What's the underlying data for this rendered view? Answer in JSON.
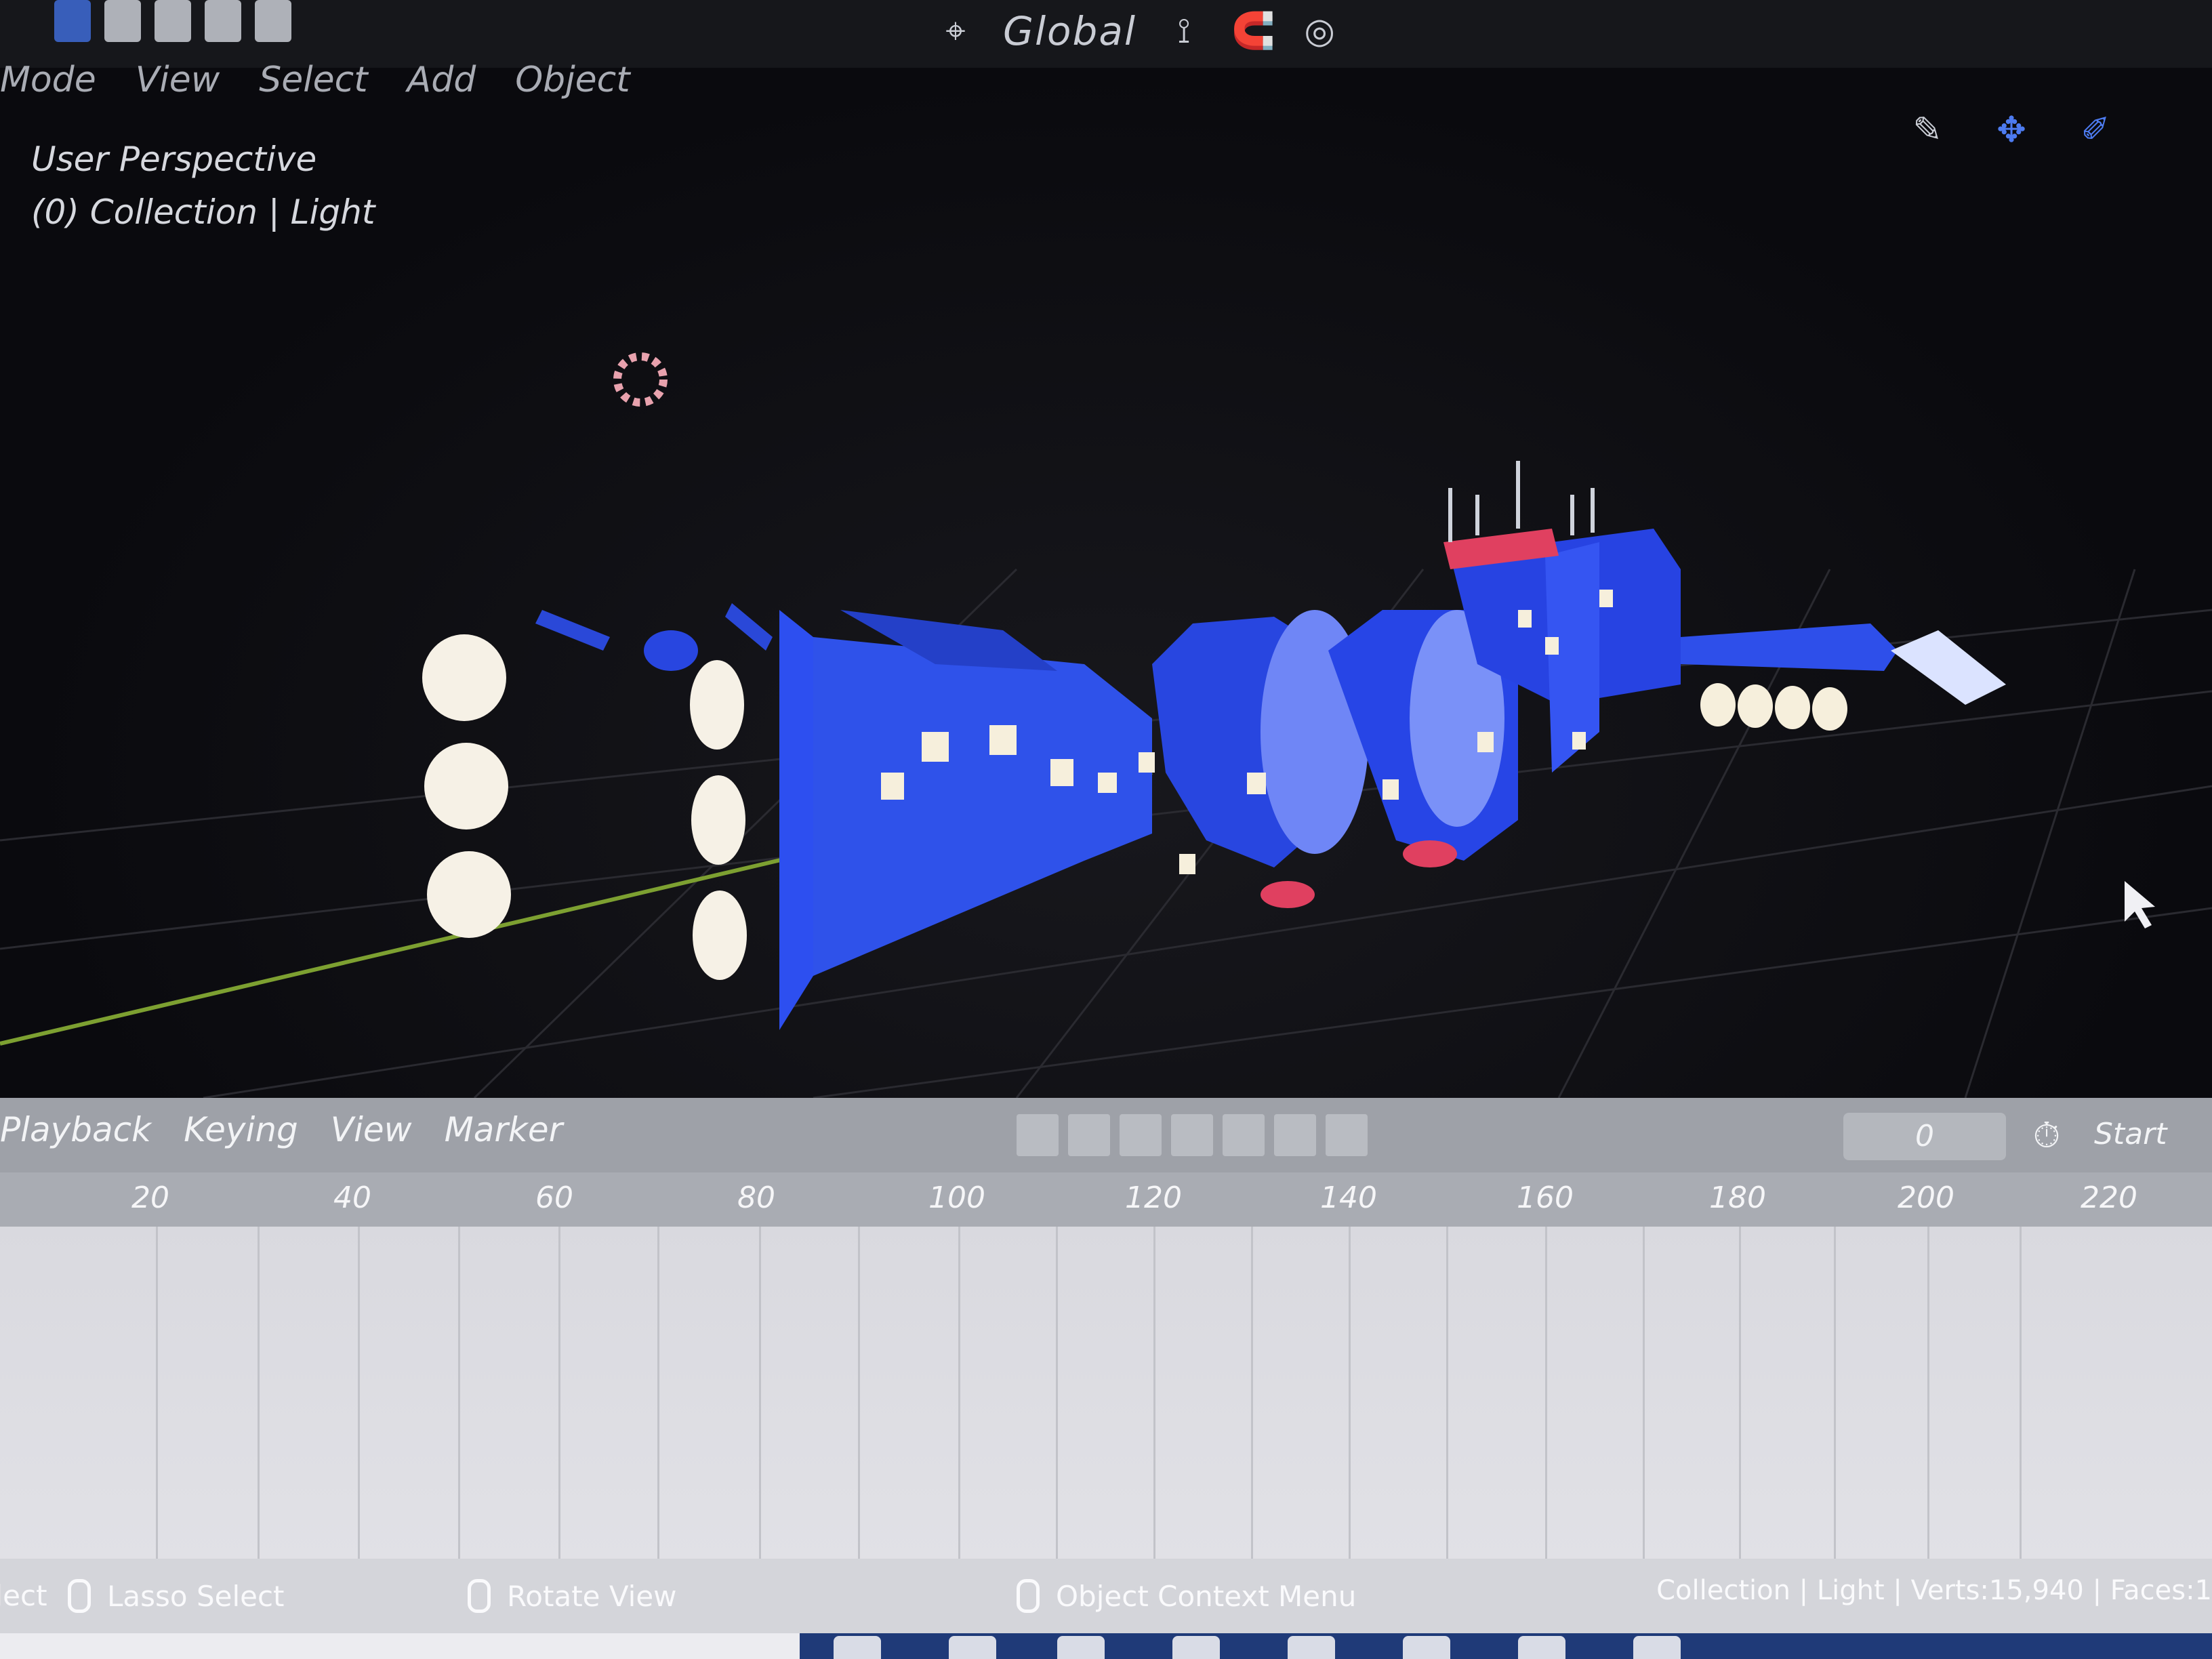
{
  "header": {
    "transform_orientation": "Global"
  },
  "viewport": {
    "menu": [
      "Mode",
      "View",
      "Select",
      "Add",
      "Object"
    ],
    "perspective_label": "User Perspective",
    "collection_label": "(0) Collection | Light"
  },
  "timeline": {
    "menu": [
      "Playback",
      "Keying",
      "View",
      "Marker"
    ],
    "current_frame": "0",
    "start_label": "Start",
    "ticks": [
      "20",
      "40",
      "60",
      "80",
      "100",
      "120",
      "140",
      "160",
      "180",
      "200",
      "220"
    ]
  },
  "status_bar": {
    "select": "Select",
    "lasso_select": "Lasso Select",
    "rotate_view": "Rotate View",
    "object_context_menu": "Object Context Menu",
    "stats": "Collection | Light | Verts:15,940 | Faces:1"
  },
  "colors": {
    "accent": "#3e6bd6",
    "model_blue": "#2748e8",
    "highlight_red": "#e04060",
    "x_axis_green": "#7da031"
  },
  "icons": [
    "workspace-layout-icon",
    "global-orientation-icon",
    "snap-icon",
    "proportional-edit-icon",
    "select-tool-icon",
    "move-tool-icon",
    "annotate-tool-icon",
    "clock-icon",
    "mouse-icon",
    "mouse-cursor-icon"
  ]
}
